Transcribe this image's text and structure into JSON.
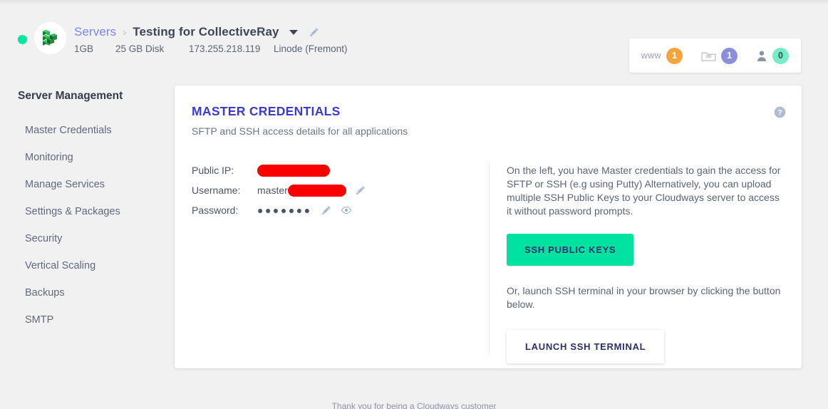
{
  "server_header": {
    "status_label": "online",
    "avatar_icon": "linode-stack-logo",
    "breadcrumb": {
      "root_label": "Servers",
      "separator": "›",
      "current_label": "Testing for CollectiveRay",
      "caret_icon": "chevron-down-icon",
      "edit_icon": "pencil-icon"
    },
    "meta": {
      "ram": "1GB",
      "disk": "25 GB Disk",
      "ip": "173.255.218.119",
      "provider": "Linode (Fremont)"
    }
  },
  "counters": [
    {
      "label": "www",
      "icon": "www-label",
      "count": "1",
      "color": "#f5a43c"
    },
    {
      "label": "",
      "icon": "database-icon",
      "count": "1",
      "color": "#8b8fdb"
    },
    {
      "label": "",
      "icon": "user-icon",
      "count": "0",
      "color": "#77ecc9"
    }
  ],
  "sidebar": {
    "title": "Server Management",
    "items": [
      {
        "label": "Master Credentials"
      },
      {
        "label": "Monitoring"
      },
      {
        "label": "Manage Services"
      },
      {
        "label": "Settings & Packages"
      },
      {
        "label": "Security"
      },
      {
        "label": "Vertical Scaling"
      },
      {
        "label": "Backups"
      },
      {
        "label": "SMTP"
      }
    ]
  },
  "card": {
    "title": "MASTER CREDENTIALS",
    "subtitle": "SFTP and SSH access details for all applications",
    "help_icon": "help-circle-icon",
    "credentials": {
      "public_ip": {
        "label": "Public IP:",
        "value": "",
        "redacted": true
      },
      "username": {
        "label": "Username:",
        "value": "master",
        "redacted": true,
        "edit_icon": "pencil-icon"
      },
      "password": {
        "label": "Password:",
        "value": "●●●●●●●",
        "edit_icon": "pencil-icon",
        "reveal_icon": "eye-icon"
      }
    },
    "info_text": "On the left, you have Master credentials to gain the access for SFTP or SSH (e.g using Putty) Alternatively, you can upload multiple SSH Public Keys to your Cloudways server to access it without password prompts.",
    "ssh_keys_button": "SSH PUBLIC KEYS",
    "terminal_hint": "Or, launch SSH terminal in your browser by clicking the button below.",
    "terminal_button": "LAUNCH SSH TERMINAL"
  },
  "footer": {
    "clipped_text": "Thank you for being a Cloudways customer"
  },
  "colors": {
    "accent_green": "#00e2a0",
    "title_blue": "#3b3bd4",
    "link_indigo": "#7b86e8",
    "redaction_red": "#fb0000",
    "page_bg": "#f1f1f1"
  }
}
